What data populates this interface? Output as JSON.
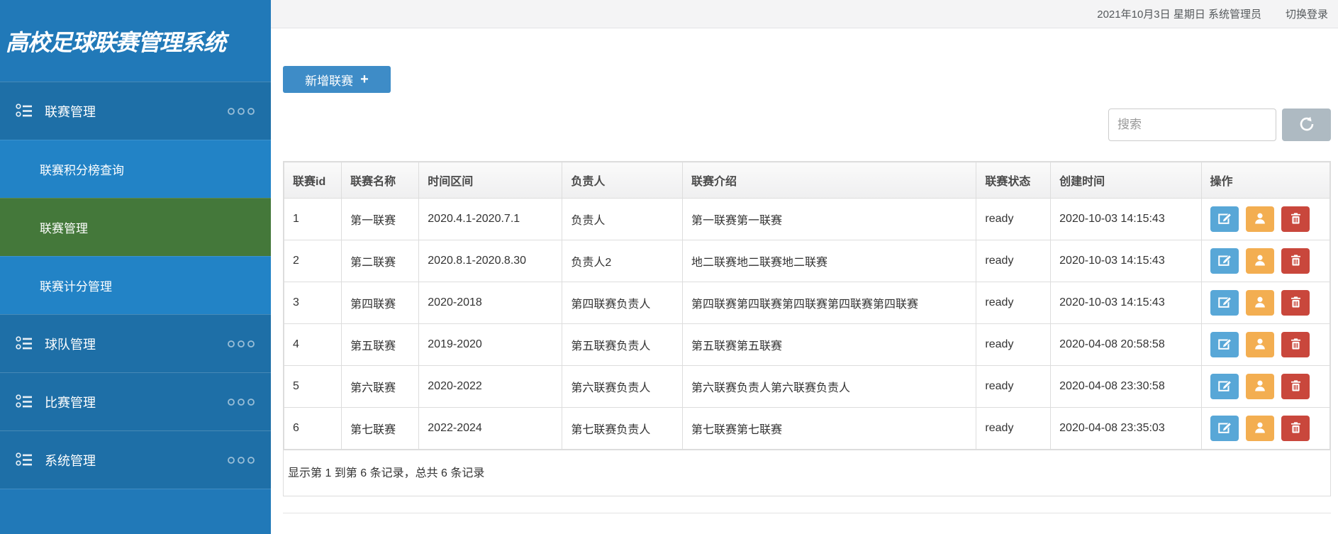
{
  "app": {
    "title": "高校足球联赛管理系统"
  },
  "topbar": {
    "date_user": "2021年10月3日 星期日 系统管理员",
    "switch_login": "切换登录"
  },
  "sidebar": {
    "items": [
      {
        "label": "联赛管理",
        "expanded": true,
        "children": [
          {
            "label": "联赛积分榜查询",
            "active": false
          },
          {
            "label": "联赛管理",
            "active": true
          },
          {
            "label": "联赛计分管理",
            "active": false
          }
        ]
      },
      {
        "label": "球队管理"
      },
      {
        "label": "比赛管理"
      },
      {
        "label": "系统管理"
      }
    ]
  },
  "toolbar": {
    "add_button_label": "新增联赛",
    "add_button_plus": "+",
    "search_placeholder": "搜索"
  },
  "table": {
    "columns": [
      "联赛id",
      "联赛名称",
      "时间区间",
      "负责人",
      "联赛介绍",
      "联赛状态",
      "创建时间",
      "操作"
    ],
    "rows": [
      {
        "id": "1",
        "name": "第一联赛",
        "period": "2020.4.1-2020.7.1",
        "manager": "负责人",
        "intro": "第一联赛第一联赛",
        "status": "ready",
        "created": "2020-10-03 14:15:43"
      },
      {
        "id": "2",
        "name": "第二联赛",
        "period": "2020.8.1-2020.8.30",
        "manager": "负责人2",
        "intro": "地二联赛地二联赛地二联赛",
        "status": "ready",
        "created": "2020-10-03 14:15:43"
      },
      {
        "id": "3",
        "name": "第四联赛",
        "period": "2020-2018",
        "manager": "第四联赛负责人",
        "intro": "第四联赛第四联赛第四联赛第四联赛第四联赛",
        "status": "ready",
        "created": "2020-10-03 14:15:43"
      },
      {
        "id": "4",
        "name": "第五联赛",
        "period": "2019-2020",
        "manager": "第五联赛负责人",
        "intro": "第五联赛第五联赛",
        "status": "ready",
        "created": "2020-04-08 20:58:58"
      },
      {
        "id": "5",
        "name": "第六联赛",
        "period": "2020-2022",
        "manager": "第六联赛负责人",
        "intro": "第六联赛负责人第六联赛负责人",
        "status": "ready",
        "created": "2020-04-08 23:30:58"
      },
      {
        "id": "6",
        "name": "第七联赛",
        "period": "2022-2024",
        "manager": "第七联赛负责人",
        "intro": "第七联赛第七联赛",
        "status": "ready",
        "created": "2020-04-08 23:35:03"
      }
    ],
    "summary": "显示第 1 到第 6 条记录，总共 6 条记录"
  },
  "colors": {
    "sidebar_blue": "#2179B8",
    "sidebar_item_blue": "#1E6FA7",
    "submenu_blue": "#2283C6",
    "active_green": "#44783A",
    "add_button_blue": "#3E8CC7",
    "refresh_gray": "#AEBAC2",
    "edit_blue": "#58A7D7",
    "user_orange": "#F3AE51",
    "delete_red": "#C9473C",
    "topbar_gray": "#F4F4F5",
    "border_gray": "#DDDDDD"
  }
}
